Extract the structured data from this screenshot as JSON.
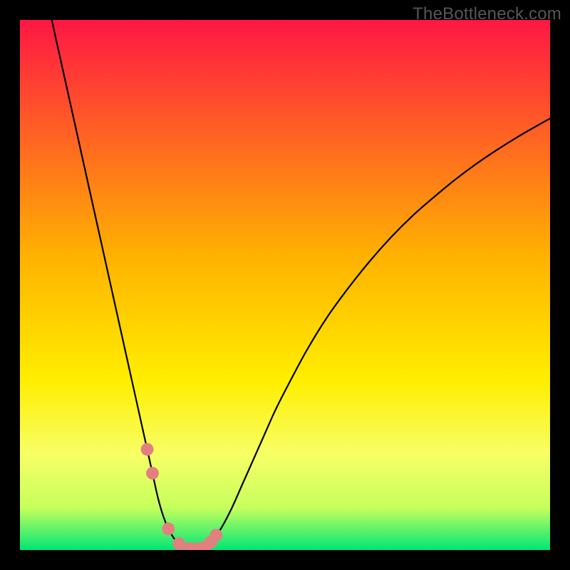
{
  "watermark": "TheBottleneck.com",
  "colors": {
    "frame": "#000000",
    "curve": "#000000",
    "marker": "#e28080",
    "gradient_stops": [
      {
        "offset": "0%",
        "color": "#ff1744"
      },
      {
        "offset": "45%",
        "color": "#ffb300"
      },
      {
        "offset": "68%",
        "color": "#ffee00"
      },
      {
        "offset": "82%",
        "color": "#f7ff66"
      },
      {
        "offset": "92%",
        "color": "#c6ff5c"
      },
      {
        "offset": "100%",
        "color": "#00e676"
      }
    ]
  },
  "chart_data": {
    "type": "line",
    "title": "",
    "xlabel": "",
    "ylabel": "",
    "xlim": [
      0,
      100
    ],
    "ylim": [
      0,
      100
    ],
    "x": [
      6,
      8,
      10,
      12,
      14,
      16,
      18,
      20,
      22,
      24,
      25,
      26,
      27,
      28,
      29,
      30,
      31,
      32,
      33,
      34,
      35,
      36,
      38,
      40,
      42,
      44,
      46,
      48,
      50,
      54,
      58,
      62,
      66,
      70,
      74,
      78,
      82,
      86,
      90,
      94,
      98,
      100
    ],
    "values": [
      100,
      91,
      82,
      73,
      64,
      55,
      46,
      37,
      28,
      19,
      14.5,
      10,
      6.5,
      4,
      2.3,
      1.2,
      0.6,
      0.3,
      0.2,
      0.3,
      0.6,
      1.5,
      4.2,
      8,
      12.5,
      17,
      21.5,
      26,
      30,
      37.5,
      44,
      49.5,
      54.5,
      59,
      63,
      66.5,
      69.8,
      72.8,
      75.5,
      78,
      80.3,
      81.4
    ],
    "markers_x": [
      24,
      25,
      28,
      30,
      32,
      33,
      34,
      35,
      36,
      37
    ],
    "markers_y": [
      19,
      14.5,
      4,
      1.2,
      0.3,
      0.2,
      0.3,
      0.6,
      1.5,
      2.8
    ],
    "marker_radius_percent": 1.2,
    "curve_minimum_x": 33,
    "description": "V-shaped bottleneck curve: steep near-linear descent on the left, narrow trough around x≈30–35 touching ~0%, then a concave-down ascent on the right reaching ~80% at the right edge. Pink dot markers cluster along the trough."
  }
}
